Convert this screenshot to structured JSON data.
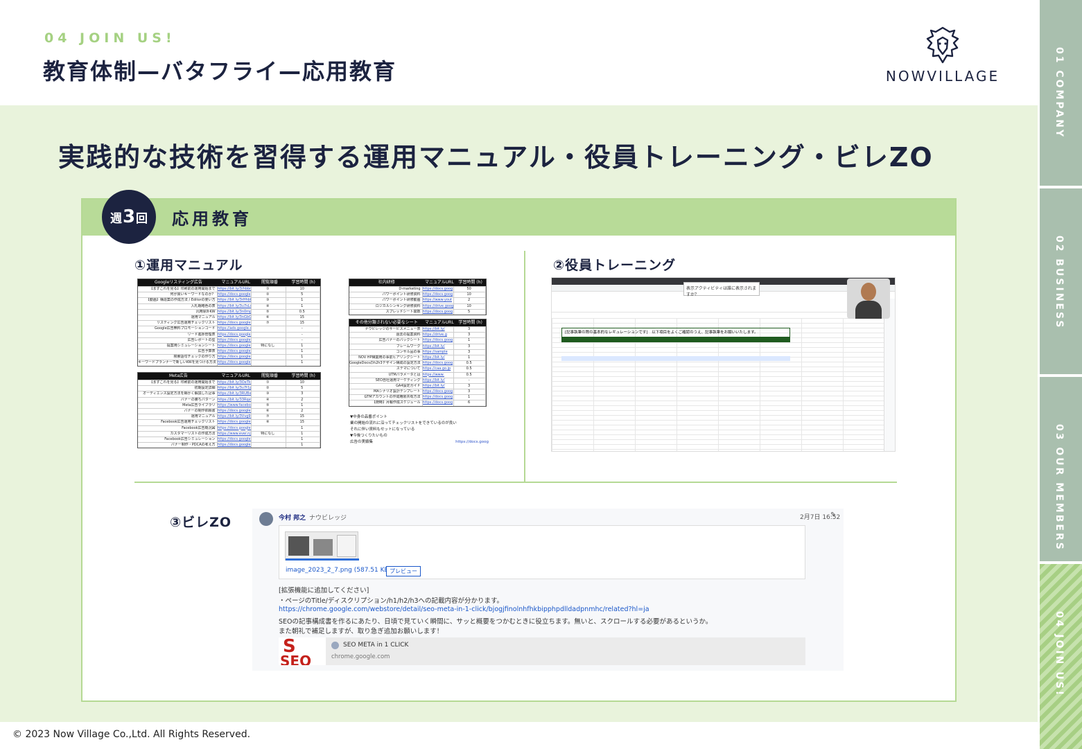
{
  "header": {
    "kicker": "04 JOIN US!",
    "title": "教育体制—バタフライ—応用教育",
    "logo_text": "NOWVILLAGE"
  },
  "headline": "実践的な技術を習得する運用マニュアル・役員トレーニング・ビレZO",
  "card": {
    "badge_prefix": "週",
    "badge_number": "3",
    "badge_suffix": "回",
    "title": "応用教育"
  },
  "sections": {
    "manual_label": "①運用マニュアル",
    "training_label": "②役員トレーニング",
    "villezo_label": "③ビレZO"
  },
  "sheets": {
    "google_ads": {
      "headers": [
        "Googleリスティング広告",
        "マニュアルURL",
        "閲覧順番",
        "学習時間 (h)"
      ],
      "rows": [
        [
          "【まずこれを見る】印刷前の運用開始まで",
          "https://bit.ly/3/hbbn",
          "①",
          "10"
        ],
        [
          "何が良いキーワードなのか？",
          "https://docs.google",
          "②",
          "5"
        ],
        [
          "【動画】構造案の作成方法 / Editorの使い方",
          "https://bit.ly/3rHhbNl",
          "③",
          "1"
        ],
        [
          "入札戦略色の表",
          "https://bit.ly/3u7sLdI",
          "④",
          "1"
        ],
        [
          "汎用除外KW",
          "https://bit.ly/3n0mpgf",
          "⑤",
          "0.5"
        ],
        [
          "運用マニュアル",
          "https://bit.ly/3nGbGf",
          "⑥",
          "15"
        ],
        [
          "リスティング広告運用チェックリスト",
          "https://docs.google.co",
          "⑦",
          "15"
        ],
        [
          "Google広告無料プロモーションコード",
          "https://ads.google.co",
          "",
          "-"
        ],
        [
          "リード進捗管理表",
          "https://docs.google.co",
          "",
          "-"
        ],
        [
          "広告レポートの型",
          "https://docs.google.co",
          "",
          "-"
        ],
        [
          "提案用シミュレーションシート",
          "https://docs.google.co",
          "特になし",
          "1"
        ],
        [
          "広告予算表",
          "https://docs.google.co",
          "",
          "1"
        ],
        [
          "検索語句チェックの作り方",
          "https://docs.google.co",
          "",
          "1"
        ],
        [
          "キーワードプランナーで新しいKWを見つける方法",
          "https://docs.google.co",
          "",
          "1"
        ]
      ]
    },
    "meta_ads": {
      "headers": [
        "Meta広告",
        "マニュアルURL",
        "閲覧順番",
        "学習時間 (h)"
      ],
      "rows": [
        [
          "【まずこれを見る】印刷前の運用開始まで",
          "https://bit.ly/3OeTkw",
          "①",
          "10"
        ],
        [
          "初期設定詳細",
          "https://bit.ly/3u7t1p",
          "②",
          "5"
        ],
        [
          "オーディエンス設定方法を細かく解説した記事",
          "https://bit.ly/3RUBxQc",
          "③",
          "3"
        ],
        [
          "バナーの勝ちパターン",
          "https://bit.ly/33RqswA",
          "④",
          "2"
        ],
        [
          "Meta広告ライブラリ",
          "https://www.facebook",
          "⑤",
          "1"
        ],
        [
          "バナーの制作依頼書",
          "https://docs.google.co",
          "⑥",
          "2"
        ],
        [
          "運用マニュアル",
          "https://bit.ly/3Vvg9H",
          "⑦",
          "15"
        ],
        [
          "Facebook広告運用チェックリスト",
          "https://docs.google.co",
          "⑧",
          "15"
        ],
        [
          "Facebook広告概況図",
          "https://docs.google.co",
          "",
          "1"
        ],
        [
          "カスタマーリストの作成方法",
          "https://www.ever.njel",
          "特になし",
          "1"
        ],
        [
          "Facebook広告シミュレーション",
          "https://docs.google.co",
          "",
          "1"
        ],
        [
          "バナー制作・PDCAの考え方",
          "https://docs.google.co",
          "",
          "1"
        ]
      ]
    },
    "internal": {
      "headers": [
        "社内研修",
        "マニュアルURL",
        "学習時間 (h)"
      ],
      "rows": [
        [
          "D-marketing",
          "https://docs.goog",
          "50"
        ],
        [
          "パワーポイント研修資料",
          "https://docs.goog",
          "10"
        ],
        [
          "パワーポイント研修動画",
          "https://www.yout",
          "2"
        ],
        [
          "ロジカルシンキング研修資料",
          "https://drive.goog",
          "10"
        ],
        [
          "スプレッドシート関数",
          "https://docs.goog",
          "5"
        ]
      ]
    },
    "other": {
      "headers": [
        "その他分類されない必要なシート",
        "マニュアルURL",
        "学習時間 (h)"
      ],
      "rows": [
        [
          "ナウビレッジのサービスメニュー表",
          "https://bit.ly/",
          "3"
        ],
        [
          "過去の提案資料",
          "https://drive.g",
          "3"
        ],
        [
          "広告バナーのバックシート",
          "https://docs.goog",
          "1"
        ],
        [
          "フレームワーク",
          "https://bit.ly/",
          "3"
        ],
        [
          "コンサル品の事",
          "https://sample",
          "3"
        ],
        [
          "NOV HP構築用の事前ヒアリングシート",
          "https://bit.ly/",
          "1"
        ],
        [
          "GoogleDocsのh2h3デザイン構成の設定方法",
          "https://docs.goog",
          "0.5"
        ],
        [
          "ステマについて",
          "https://caa.go.jp",
          "0.5"
        ],
        [
          "UTMパラメータとは",
          "https://www.",
          "0.5"
        ],
        [
          "SEO自社運用マーケティング",
          "https://bit.ly/",
          "-"
        ],
        [
          "GA4設定ガイド",
          "https://bit.ly/",
          "3"
        ],
        [
          "MAシナリオ設計テンプレート",
          "https://docs.goog",
          "3"
        ],
        [
          "GTMアカウントの作成権限共有方法",
          "https://docs.goog",
          "1"
        ],
        [
          "【随時】月報作成スケジュール",
          "https://docs.goog",
          "6"
        ]
      ]
    },
    "notes": [
      "▼中身の品番ポイント",
      "業の開始の流れに沿ってチェックリストをできているのが良い",
      "それに伴い資料もセットになっている",
      "▼今後つくりたいもの",
      "広告の実績集",
      "https://docs.goog"
    ]
  },
  "training_shot": {
    "popup_text": "表示アクティビティは誰に表示されますか？",
    "sheet_title": "[記事執筆の際の基本的なレギュレーションです]　以下項目をよくご確認のうえ、記事執筆をお願いいたします。"
  },
  "chat": {
    "name": "今村 邦之",
    "org": "ナウビレッジ",
    "time": "2月7日 16:52",
    "file_name": "image_2023_2_7.png (587.51 KB)",
    "preview_button": "プレビュー",
    "line1": "[拡張機能に追加してください]",
    "line2": "・ページのTitle/ディスクリプション/h1/h2/h3への記載内容が分かります。",
    "link": "https://chrome.google.com/webstore/detail/seo-meta-in-1-click/bjogjfinolnhfhkbipphpdlldadpnmhc/related?hl=ja",
    "line3": "SEOの記事構成書を作るにあたり、日頃で見ていく瞬間に、サッと概要をつかむときに役立ちます。無いと、スクロールする必要があるというか。",
    "line4": "また朝礼で補足しますが、取り急ぎ追加お願いします！",
    "card_title": "SEO META in 1 CLICK",
    "card_domain": "chrome.google.com",
    "card_image_text_top": "S",
    "card_image_text_bottom": "SEO"
  },
  "footer": {
    "copyright": "© 2023  Now Village Co.,Ltd. All Rights Reserved."
  },
  "nav": {
    "items": [
      {
        "label": "01 COMPANY",
        "active": false
      },
      {
        "label": "02 BUSINESS",
        "active": false
      },
      {
        "label": "03 OUR MEMBERS",
        "active": false
      },
      {
        "label": "04 JOIN US!",
        "active": true
      }
    ]
  },
  "colors": {
    "navy": "#1c2340",
    "accent_green": "#a5d182",
    "band_green": "#e9f3dc",
    "card_head_green": "#b8db98",
    "nav_gray_green": "#a9bfae"
  }
}
